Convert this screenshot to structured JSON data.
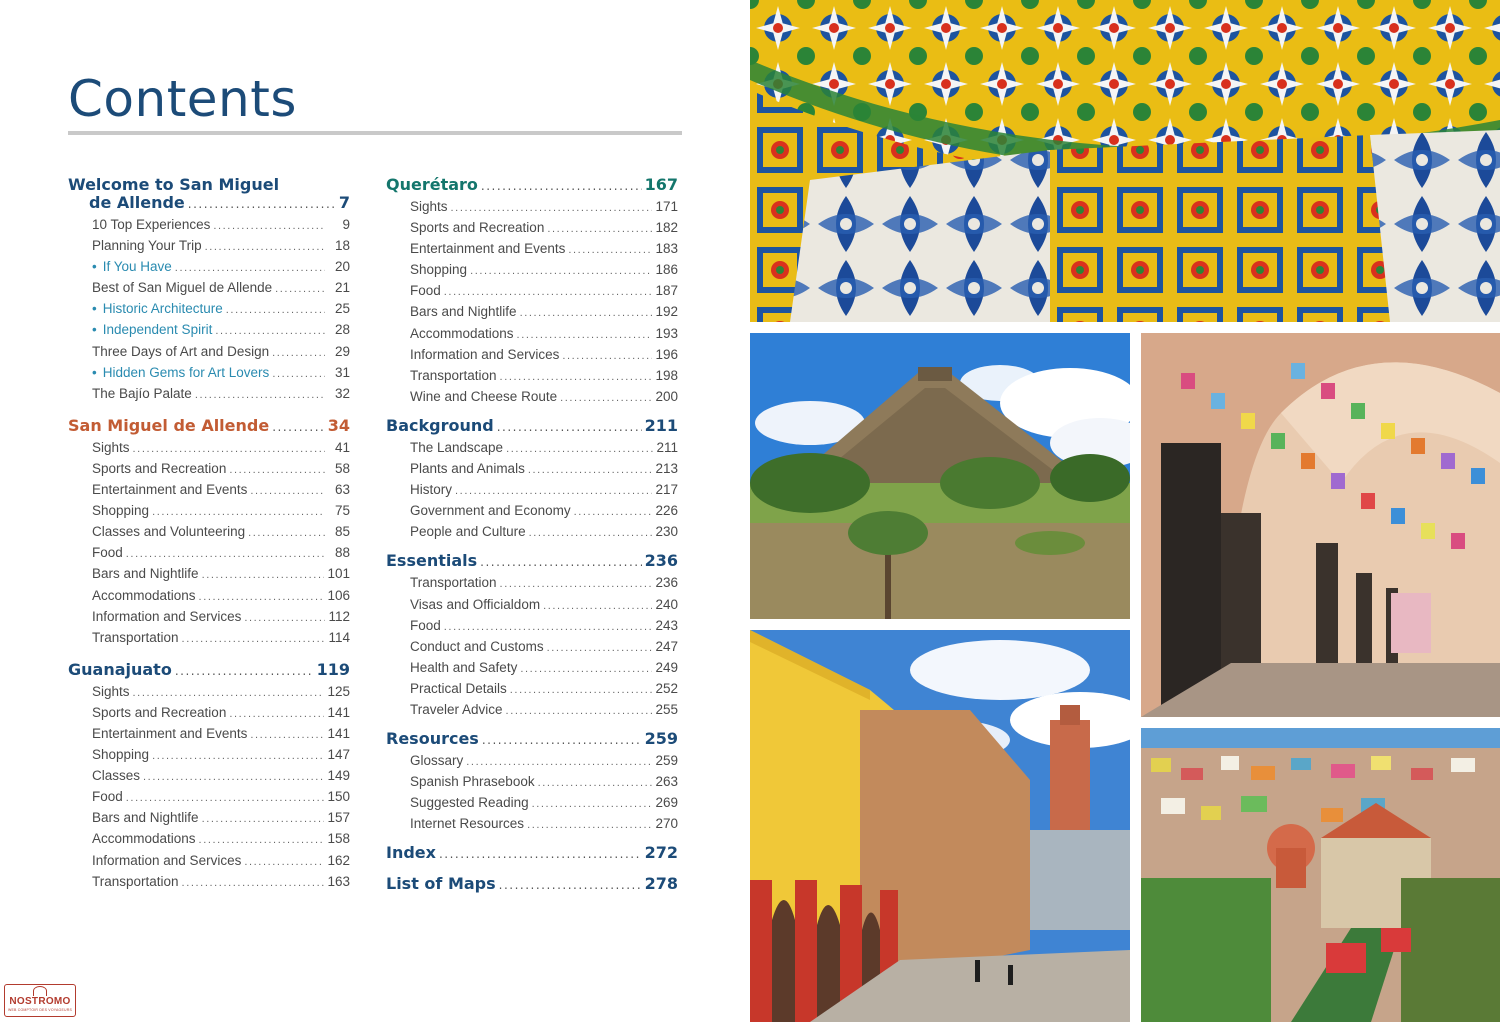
{
  "title": "Contents",
  "stamp": {
    "name": "NOSTROMO",
    "tagline": "WEB COMPTOIR DES VOYAGEURS"
  },
  "sections": {
    "welcome": {
      "title_line1": "Welcome to San Miguel",
      "title_line2": "de Allende",
      "page": "7",
      "items": [
        {
          "label": "10 Top Experiences",
          "page": "9"
        },
        {
          "label": "Planning Your Trip",
          "page": "18"
        },
        {
          "label": "If You Have",
          "page": "20",
          "sub": true
        },
        {
          "label": "Best of San Miguel de Allende",
          "page": "21"
        },
        {
          "label": "Historic Architecture",
          "page": "25",
          "sub": true
        },
        {
          "label": "Independent Spirit",
          "page": "28",
          "sub": true
        },
        {
          "label": "Three Days of Art and Design",
          "page": "29"
        },
        {
          "label": "Hidden Gems for Art Lovers",
          "page": "31",
          "sub": true
        },
        {
          "label": "The Bajío Palate",
          "page": "32"
        }
      ]
    },
    "sma": {
      "title": "San Miguel de Allende",
      "page": "34",
      "items": [
        {
          "label": "Sights",
          "page": "41"
        },
        {
          "label": "Sports and Recreation",
          "page": "58"
        },
        {
          "label": "Entertainment and Events",
          "page": "63"
        },
        {
          "label": "Shopping",
          "page": "75"
        },
        {
          "label": "Classes and Volunteering",
          "page": "85"
        },
        {
          "label": "Food",
          "page": "88"
        },
        {
          "label": "Bars and Nightlife",
          "page": "101"
        },
        {
          "label": "Accommodations",
          "page": "106"
        },
        {
          "label": "Information and Services",
          "page": "112"
        },
        {
          "label": "Transportation",
          "page": "114"
        }
      ]
    },
    "guanajuato": {
      "title": "Guanajuato",
      "page": "119",
      "items": [
        {
          "label": "Sights",
          "page": "125"
        },
        {
          "label": "Sports and Recreation",
          "page": "141"
        },
        {
          "label": "Entertainment and Events",
          "page": "141"
        },
        {
          "label": "Shopping",
          "page": "147"
        },
        {
          "label": "Classes",
          "page": "149"
        },
        {
          "label": "Food",
          "page": "150"
        },
        {
          "label": "Bars and Nightlife",
          "page": "157"
        },
        {
          "label": "Accommodations",
          "page": "158"
        },
        {
          "label": "Information and Services",
          "page": "162"
        },
        {
          "label": "Transportation",
          "page": "163"
        }
      ]
    },
    "queretaro": {
      "title": "Querétaro",
      "page": "167",
      "items": [
        {
          "label": "Sights",
          "page": "171"
        },
        {
          "label": "Sports and Recreation",
          "page": "182"
        },
        {
          "label": "Entertainment and Events",
          "page": "183"
        },
        {
          "label": "Shopping",
          "page": "186"
        },
        {
          "label": "Food",
          "page": "187"
        },
        {
          "label": "Bars and Nightlife",
          "page": "192"
        },
        {
          "label": "Accommodations",
          "page": "193"
        },
        {
          "label": "Information and Services",
          "page": "196"
        },
        {
          "label": "Transportation",
          "page": "198"
        },
        {
          "label": "Wine and Cheese Route",
          "page": "200"
        }
      ]
    },
    "background": {
      "title": "Background",
      "page": "211",
      "items": [
        {
          "label": "The Landscape",
          "page": "211"
        },
        {
          "label": "Plants and Animals",
          "page": "213"
        },
        {
          "label": "History",
          "page": "217"
        },
        {
          "label": "Government and Economy",
          "page": "226"
        },
        {
          "label": "People and Culture",
          "page": "230"
        }
      ]
    },
    "essentials": {
      "title": "Essentials",
      "page": "236",
      "items": [
        {
          "label": "Transportation",
          "page": "236"
        },
        {
          "label": "Visas and Officialdom",
          "page": "240"
        },
        {
          "label": "Food",
          "page": "243"
        },
        {
          "label": "Conduct and Customs",
          "page": "247"
        },
        {
          "label": "Health and Safety",
          "page": "249"
        },
        {
          "label": "Practical Details",
          "page": "252"
        },
        {
          "label": "Traveler Advice",
          "page": "255"
        }
      ]
    },
    "resources": {
      "title": "Resources",
      "page": "259",
      "items": [
        {
          "label": "Glossary",
          "page": "259"
        },
        {
          "label": "Spanish Phrasebook",
          "page": "263"
        },
        {
          "label": "Suggested Reading",
          "page": "269"
        },
        {
          "label": "Internet Resources",
          "page": "270"
        }
      ]
    },
    "index": {
      "title": "Index",
      "page": "272"
    },
    "maps": {
      "title": "List of Maps",
      "page": "278"
    }
  },
  "colors": {
    "heading_blue": "#1c4b78",
    "heading_orange": "#c25c34",
    "heading_teal": "#14766c",
    "sub_item_blue": "#2a8bb0"
  }
}
